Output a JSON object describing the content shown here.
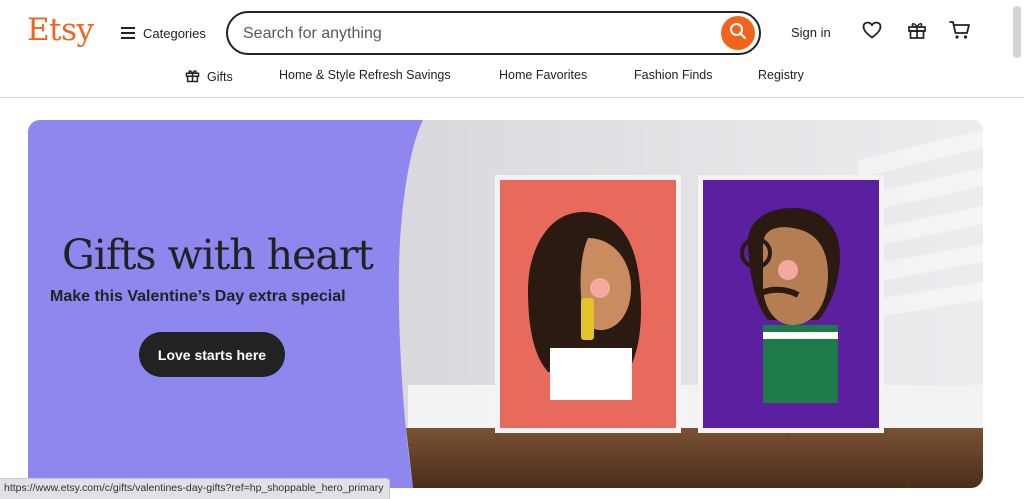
{
  "header": {
    "logo": "Etsy",
    "categories_label": "Categories",
    "search_placeholder": "Search for anything",
    "signin_label": "Sign in",
    "icons": [
      "menu-icon",
      "search-icon",
      "heart-icon",
      "gift-icon",
      "cart-icon"
    ]
  },
  "nav": {
    "items": [
      {
        "label": "Gifts",
        "icon": "gift-icon"
      },
      {
        "label": "Home & Style Refresh Savings"
      },
      {
        "label": "Home Favorites"
      },
      {
        "label": "Fashion Finds"
      },
      {
        "label": "Registry"
      }
    ]
  },
  "hero": {
    "title": "Gifts with heart",
    "subtitle": "Make this Valentine’s Day extra special",
    "cta_label": "Love starts here"
  },
  "status_bar": {
    "url": "https://www.etsy.com/c/gifts/valentines-day-gifts?ref=hp_shoppable_hero_primary"
  },
  "colors": {
    "brand": "#f1641e",
    "hero_bg": "#8d87ee",
    "text": "#222222"
  }
}
